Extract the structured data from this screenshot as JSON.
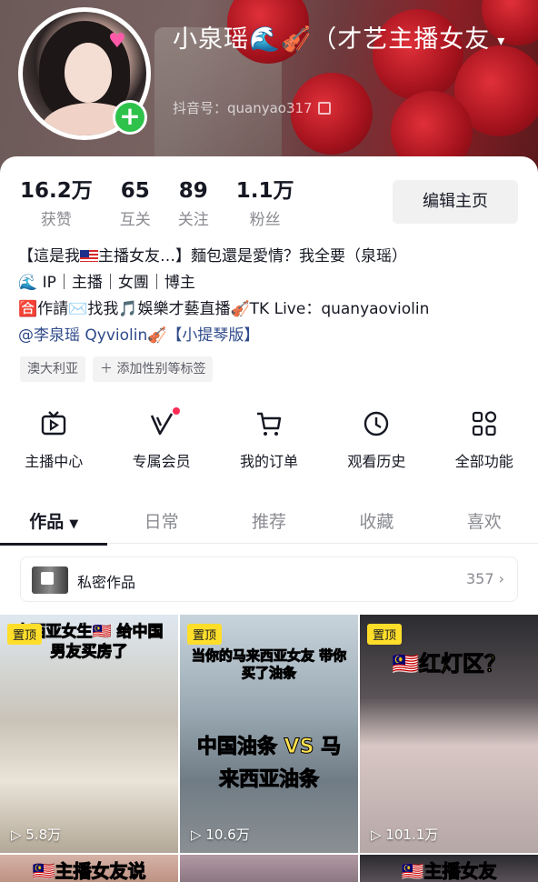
{
  "profile": {
    "nickname": "小泉瑶🌊🎻（才艺主播女友",
    "douyin_id": "抖音号：quanyao317",
    "avatar_plus": "+"
  },
  "stats": [
    {
      "num": "16.2万",
      "label": "获赞"
    },
    {
      "num": "65",
      "label": "互关"
    },
    {
      "num": "89",
      "label": "关注"
    },
    {
      "num": "1.1万",
      "label": "粉丝"
    }
  ],
  "edit_button": "编辑主页",
  "bio": {
    "line1_a": "【這是我",
    "line1_b": "主播女友…】麵包還是愛情？我全要（泉瑶）",
    "line2": "🌊 IP｜主播｜女團｜博主",
    "line3": "🈴作請✉️找我🎵娛樂才藝直播🎻TK Live：quanyaoviolin",
    "line4": "@李泉瑶 Qyviolin🎻【小提琴版】"
  },
  "tags": [
    "澳大利亚",
    "＋ 添加性别等标签"
  ],
  "functions": [
    {
      "label": "主播中心",
      "icon": "tv-icon"
    },
    {
      "label": "专属会员",
      "icon": "v-icon"
    },
    {
      "label": "我的订单",
      "icon": "cart-icon"
    },
    {
      "label": "观看历史",
      "icon": "clock-icon"
    },
    {
      "label": "全部功能",
      "icon": "grid-icon"
    }
  ],
  "tabs": [
    "作品",
    "日常",
    "推荐",
    "收藏",
    "喜欢"
  ],
  "private_works": {
    "label": "私密作品",
    "count": "357 ›"
  },
  "videos": [
    {
      "pin": "置顶",
      "caption": "来西亚女生🇲🇾 给中国男友买房了",
      "plays": "▷ 5.8万"
    },
    {
      "pin": "置顶",
      "caption": "当你的马来西亚女友 带你买了油条",
      "caption2": "中国油条 VS 马来西亚油条",
      "plays": "▷ 10.6万"
    },
    {
      "pin": "置顶",
      "caption": "🇲🇾红灯区？",
      "plays": "▷ 101.1万"
    },
    {
      "caption": "🇲🇾主播女友说"
    },
    {
      "caption": ""
    },
    {
      "caption": "🇲🇾主播女友"
    }
  ],
  "colors": {
    "accent_green": "#2ec24b",
    "pin_yellow": "#ffde2a",
    "dot_red": "#fe2c55",
    "link_blue": "#2e4a8a"
  }
}
